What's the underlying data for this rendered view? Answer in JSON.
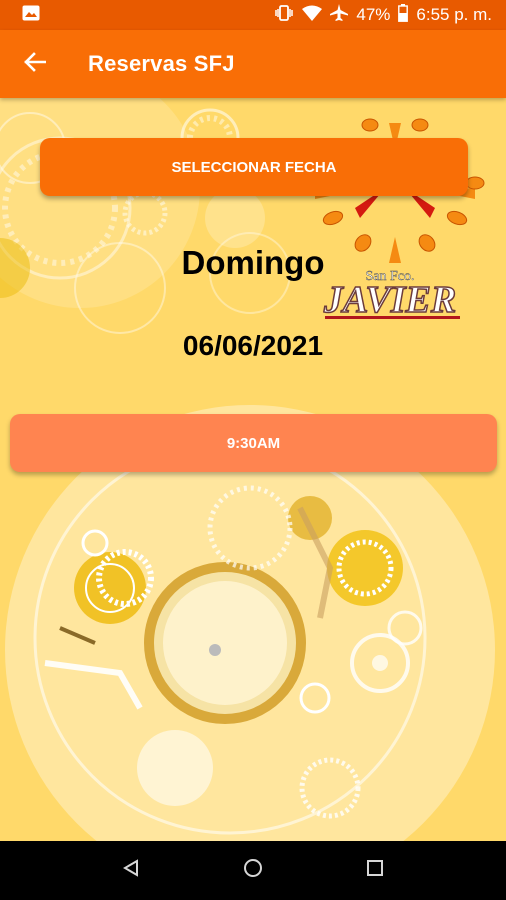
{
  "status_bar": {
    "battery_percent": "47%",
    "time": "6:55 p. m."
  },
  "app_bar": {
    "title": "Reservas SFJ"
  },
  "main": {
    "select_date_label": "SELECCIONAR FECHA",
    "day_name": "Domingo",
    "date": "06/06/2021",
    "time_slots": [
      {
        "label": "9:30AM"
      }
    ],
    "logo_text": {
      "top": "San Fco.",
      "main": "JAVIER"
    }
  },
  "icons": {
    "back": "arrow-left-icon",
    "image_notification": "image-icon",
    "vibrate": "vibrate-icon",
    "wifi": "wifi-icon",
    "airplane": "airplane-icon",
    "battery": "battery-icon",
    "nav_back": "triangle-back-icon",
    "nav_home": "circle-home-icon",
    "nav_recents": "square-recents-icon"
  },
  "colors": {
    "status_bar": "#e85a00",
    "app_bar": "#f96e06",
    "background": "#ffd96a",
    "select_button": "#f96e06",
    "time_button": "#ff8450"
  }
}
